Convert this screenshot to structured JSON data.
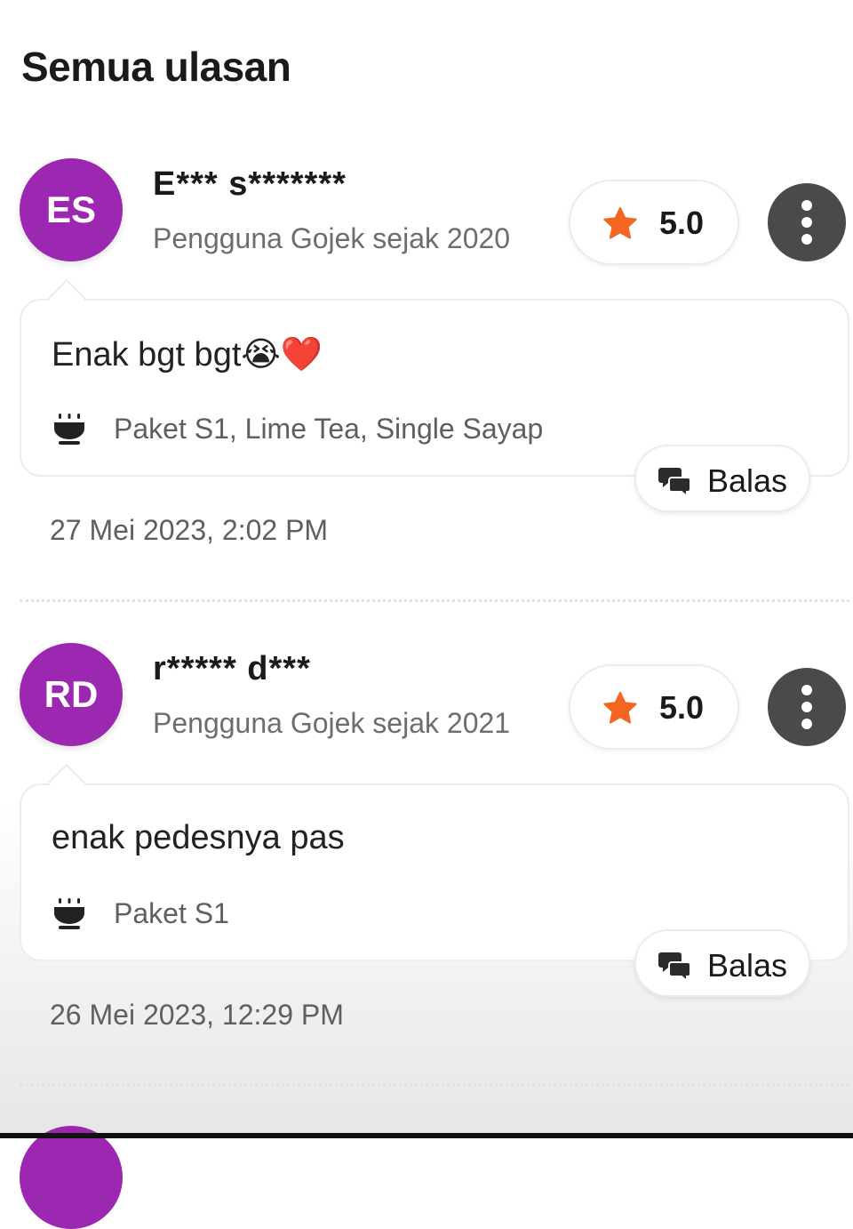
{
  "page": {
    "title": "Semua ulasan"
  },
  "colors": {
    "avatar_purple": "#9c27b0",
    "star_orange": "#f26522",
    "more_button_bg": "#4a4a4a"
  },
  "reviews": [
    {
      "initials": "ES",
      "name": "E*** s*******",
      "since": "Pengguna Gojek sejak 2020",
      "rating": "5.0",
      "comment": "Enak bgt bgt😭❤️",
      "items": "Paket S1, Lime Tea, Single Sayap",
      "reply_label": "Balas",
      "date": "27 Mei 2023, 2:02 PM"
    },
    {
      "initials": "RD",
      "name": "r***** d***",
      "since": "Pengguna Gojek sejak 2021",
      "rating": "5.0",
      "comment": "enak pedesnya pas",
      "items": "Paket S1",
      "reply_label": "Balas",
      "date": "26 Mei 2023, 12:29 PM"
    }
  ],
  "icons": {
    "rating": "star-icon",
    "more": "more-vertical-icon",
    "items": "bowl-icon",
    "reply": "chat-bubbles-icon"
  }
}
